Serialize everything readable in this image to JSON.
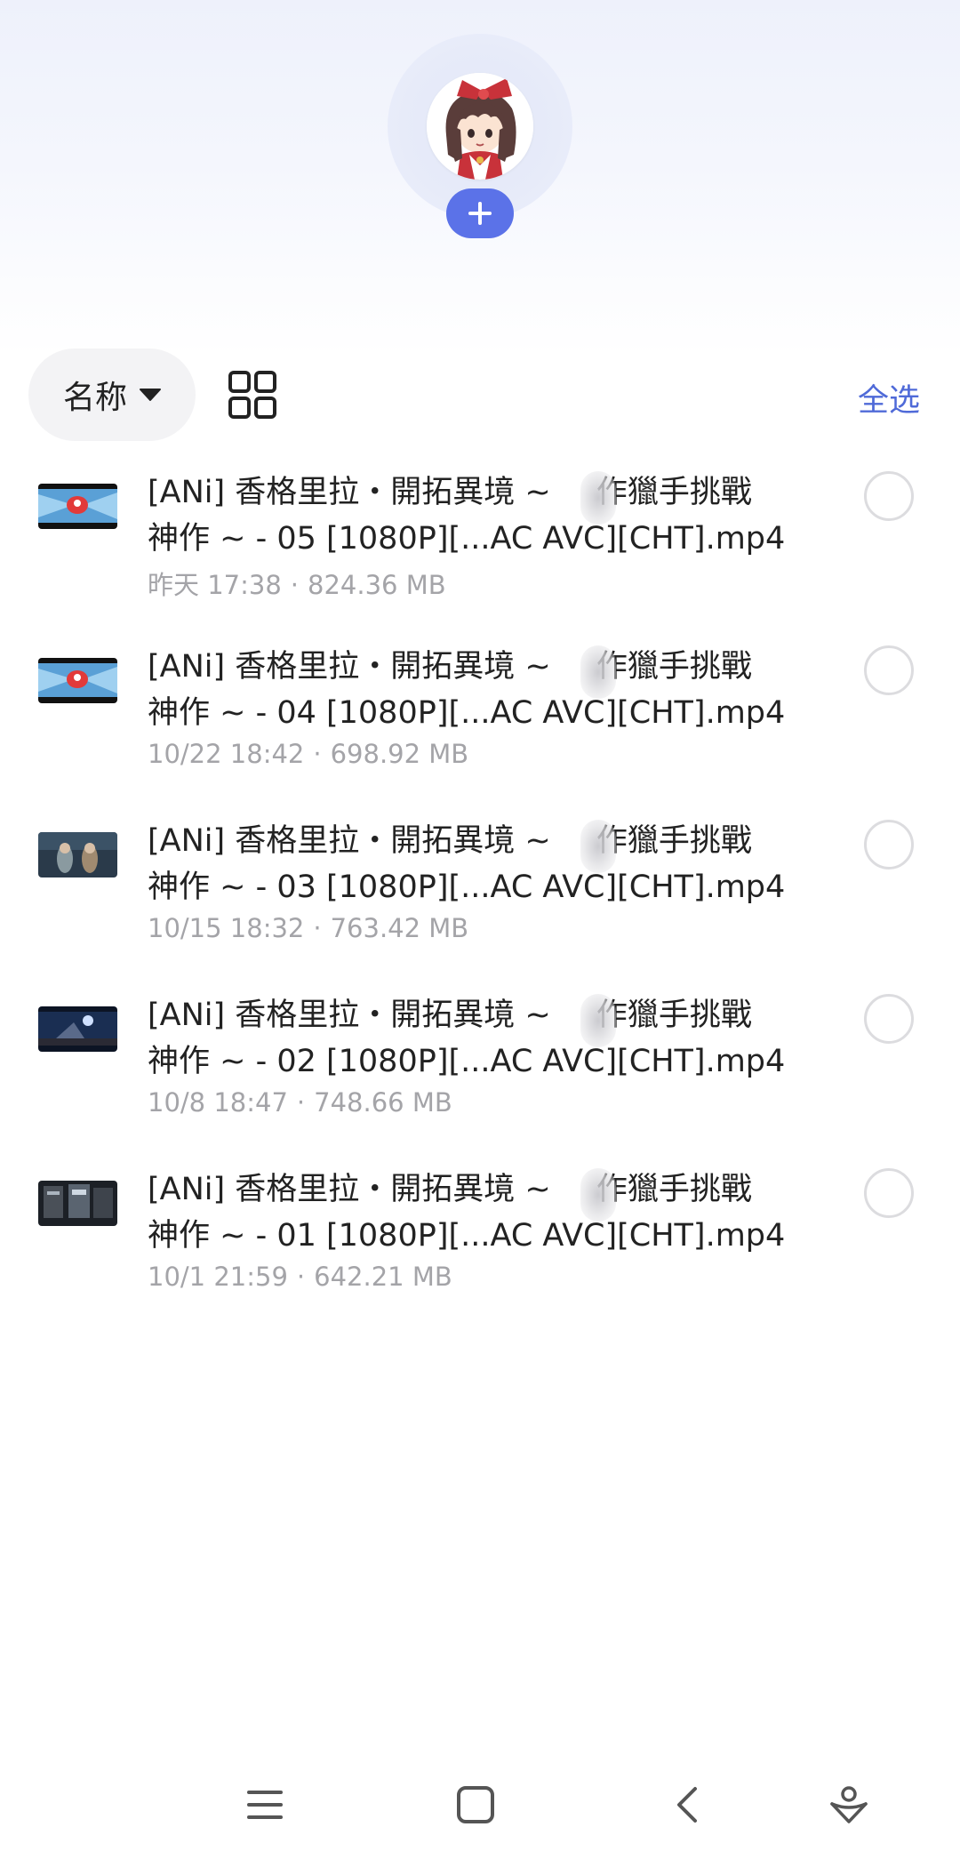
{
  "header": {
    "avatar_icon": "anime-girl-avatar",
    "add_icon": "plus-icon"
  },
  "toolbar": {
    "sort_label": "名称",
    "sort_icon": "caret-down-icon",
    "view_icon": "grid-view-icon",
    "select_all_label": "全选"
  },
  "files": [
    {
      "name_line1": "[ANi] 香格里拉・開拓異境 ~ ",
      "name_line1_rest": "作獵手挑戰",
      "name_line2": "神作 ~ - 05 [1080P][...AC AVC][CHT].mp4",
      "date": "昨天 17:38",
      "size": "824.36 MB"
    },
    {
      "name_line1": "[ANi] 香格里拉・開拓異境 ~ ",
      "name_line1_rest": "作獵手挑戰",
      "name_line2": "神作 ~ - 04 [1080P][...AC AVC][CHT].mp4",
      "date": "10/22 18:42",
      "size": "698.92 MB"
    },
    {
      "name_line1": "[ANi] 香格里拉・開拓異境 ~ ",
      "name_line1_rest": "作獵手挑戰",
      "name_line2": "神作 ~ - 03 [1080P][...AC AVC][CHT].mp4",
      "date": "10/15 18:32",
      "size": "763.42 MB"
    },
    {
      "name_line1": "[ANi] 香格里拉・開拓異境 ~ ",
      "name_line1_rest": "作獵手挑戰",
      "name_line2": "神作 ~ - 02 [1080P][...AC AVC][CHT].mp4",
      "date": "10/8 18:47",
      "size": "748.66 MB"
    },
    {
      "name_line1": "[ANi] 香格里拉・開拓異境 ~ ",
      "name_line1_rest": "作獵手挑戰",
      "name_line2": "神作 ~ - 01 [1080P][...AC AVC][CHT].mp4",
      "date": "10/1 21:59",
      "size": "642.21 MB"
    }
  ],
  "nav": {
    "menu_icon": "menu-icon",
    "home_icon": "home-square-icon",
    "back_icon": "back-chevron-icon",
    "assistant_icon": "assistant-icon"
  },
  "colors": {
    "accent": "#5b72e8",
    "select_all": "#4f6ad8",
    "meta_text": "#a4a4a8",
    "circle_border": "#dcdcdf"
  }
}
